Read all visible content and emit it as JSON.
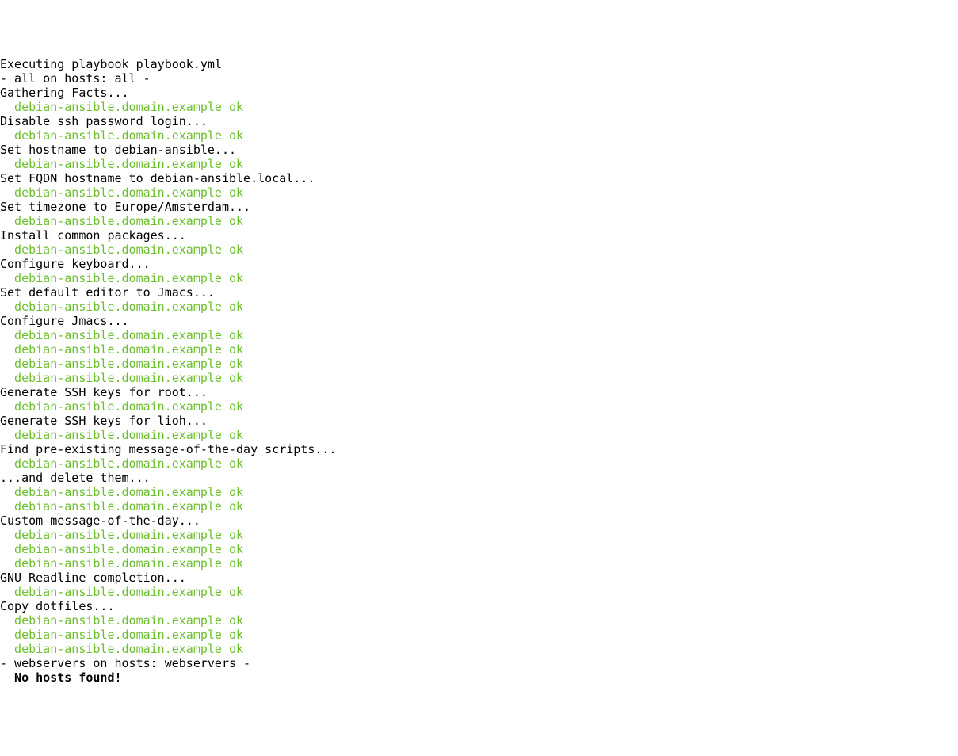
{
  "title": "Executing playbook playbook.yml",
  "blank": "",
  "play_header_all": "- all on hosts: all -",
  "host_ok": "debian-ansible.domain.example ok",
  "tasks_all": [
    {
      "label": "Gathering Facts...",
      "results": 1
    },
    {
      "label": "Disable ssh password login...",
      "results": 1
    },
    {
      "label": "Set hostname to debian-ansible...",
      "results": 1
    },
    {
      "label": "Set FQDN hostname to debian-ansible.local...",
      "results": 1
    },
    {
      "label": "Set timezone to Europe/Amsterdam...",
      "results": 1
    },
    {
      "label": "Install common packages...",
      "results": 1
    },
    {
      "label": "Configure keyboard...",
      "results": 1
    },
    {
      "label": "Set default editor to Jmacs...",
      "results": 1
    },
    {
      "label": "Configure Jmacs...",
      "results": 4
    },
    {
      "label": "Generate SSH keys for root...",
      "results": 1
    },
    {
      "label": "Generate SSH keys for lioh...",
      "results": 1
    },
    {
      "label": "Find pre-existing message-of-the-day scripts...",
      "results": 1
    },
    {
      "label": "...and delete them...",
      "results": 2
    },
    {
      "label": "Custom message-of-the-day...",
      "results": 3
    },
    {
      "label": "GNU Readline completion...",
      "results": 1
    },
    {
      "label": "Copy dotfiles...",
      "results": 3
    }
  ],
  "play_header_webservers": "- webservers on hosts: webservers -",
  "no_hosts": "No hosts found!"
}
